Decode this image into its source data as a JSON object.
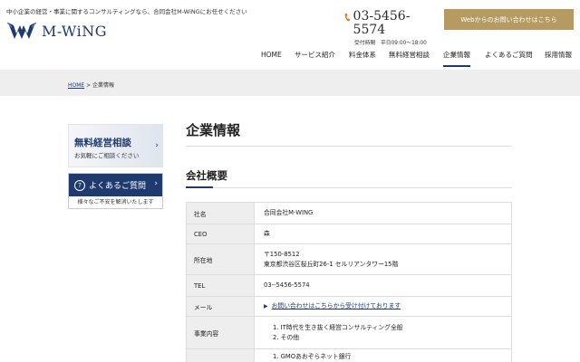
{
  "header": {
    "tagline": "中小企業の経営・事業に関するコンサルティングなら、合同会社M-WiNGにお任せください",
    "logo_text": "M-WiNG",
    "phone_number": "03-5456-5574",
    "hours": "受付時間　平日09:00〜18:00",
    "contact_button": "Webからのお問い合わせはこちら"
  },
  "nav": {
    "items": [
      {
        "label": "HOME",
        "active": false
      },
      {
        "label": "サービス紹介",
        "active": false
      },
      {
        "label": "料金体系",
        "active": false
      },
      {
        "label": "無料経営相談",
        "active": false
      },
      {
        "label": "企業情報",
        "active": true
      },
      {
        "label": "よくあるご質問",
        "active": false
      },
      {
        "label": "採用情報",
        "active": false
      }
    ]
  },
  "breadcrumb": {
    "home": "HOME",
    "separator": " > ",
    "current": "企業情報"
  },
  "sidebar": {
    "consult_banner": {
      "title": "無料経営相談",
      "subtitle": "お気軽にご相談ください"
    },
    "faq_banner": {
      "title": "よくあるご質問",
      "subtitle": "様々なご不安を解消いたします"
    }
  },
  "main": {
    "page_title": "企業情報",
    "section_title": "会社概要",
    "table": {
      "company_label": "社名",
      "company_value": "合同会社M-WING",
      "ceo_label": "CEO",
      "ceo_value": "森",
      "address_label": "所在地",
      "address_postal": "〒150-8512",
      "address_line": "東京都渋谷区桜丘町26-1 セルリアンタワー15階",
      "tel_label": "TEL",
      "tel_value": "03--5456-5574",
      "mail_label": "メール",
      "mail_link": "お問い合わせはこちらから受け付けております",
      "business_label": "事業内容",
      "business_items": [
        "1. IT時代を生き抜く経営コンサルティング全般",
        "2. その他"
      ],
      "partial_row_text": "1. GMOあおぞらネット銀行"
    }
  },
  "colors": {
    "brand_navy": "#1e3a6e",
    "gold": "#b59a62",
    "table_header_bg": "#eeeeee"
  }
}
